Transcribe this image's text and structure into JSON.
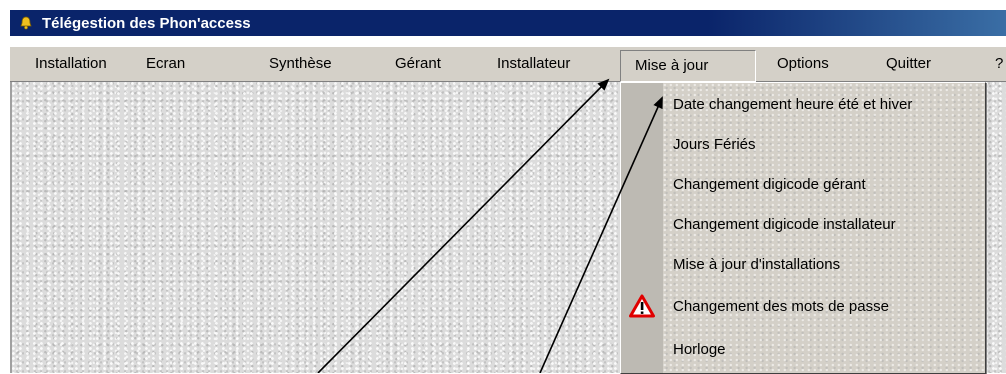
{
  "window": {
    "title": "Télégestion des Phon'access"
  },
  "menu_bar": {
    "items": [
      {
        "label": "Installation"
      },
      {
        "label": "Ecran"
      },
      {
        "label": "Synthèse"
      },
      {
        "label": "Gérant"
      },
      {
        "label": "Installateur"
      },
      {
        "label": "Mise à jour"
      },
      {
        "label": "Options"
      },
      {
        "label": "Quitter"
      },
      {
        "label": "?"
      }
    ],
    "open_item": "Mise à jour"
  },
  "dropdown": {
    "items": [
      {
        "label": "Date changement heure été et hiver"
      },
      {
        "label": "Jours Fériés"
      },
      {
        "label": "Changement digicode gérant"
      },
      {
        "label": "Changement digicode installateur"
      },
      {
        "label": "Mise à jour d'installations"
      },
      {
        "label": "Changement des mots de passe",
        "icon": "warning-icon"
      },
      {
        "label": "Horloge"
      }
    ]
  },
  "colors": {
    "title_bar": "#0a246a",
    "menu_bg": "#d4d0c8",
    "warning_red": "#e00000",
    "arrow": "#000000"
  }
}
